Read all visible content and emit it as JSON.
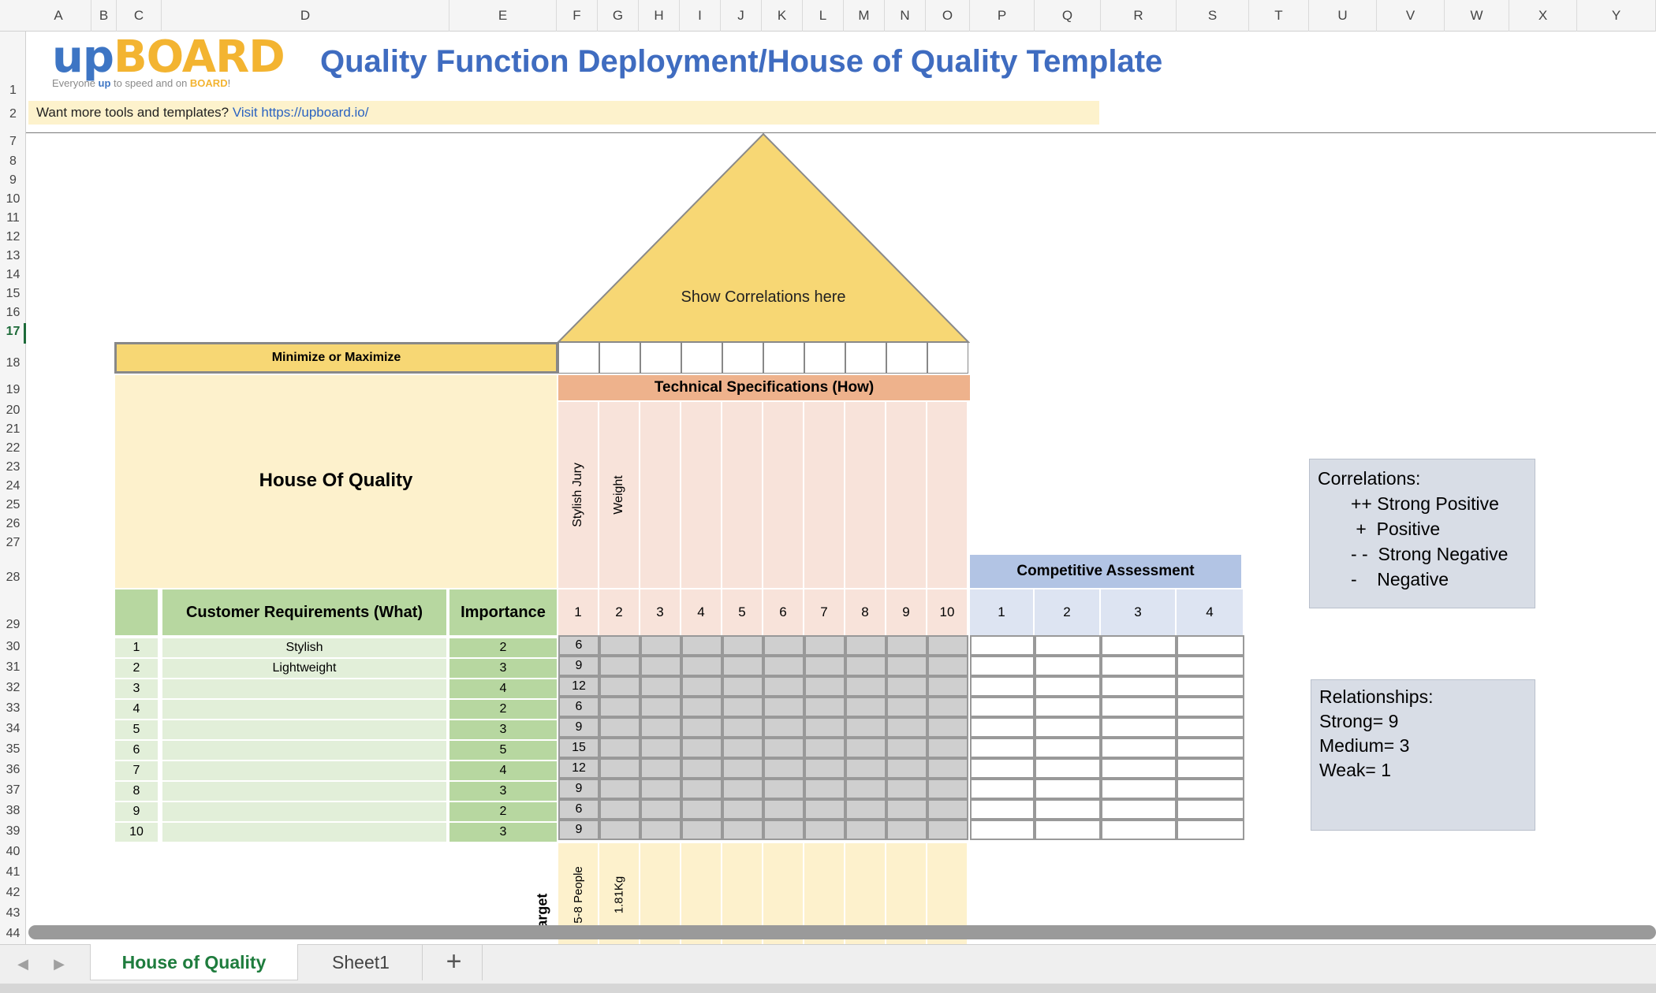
{
  "columns": [
    "A",
    "B",
    "C",
    "D",
    "E",
    "F",
    "G",
    "H",
    "I",
    "J",
    "K",
    "L",
    "M",
    "N",
    "O",
    "P",
    "Q",
    "R",
    "S",
    "T",
    "U",
    "V",
    "W",
    "X",
    "Y"
  ],
  "rows": [
    "1",
    "2",
    "7",
    "8",
    "9",
    "10",
    "11",
    "12",
    "13",
    "14",
    "15",
    "16",
    "17",
    "18",
    "19",
    "20",
    "21",
    "22",
    "23",
    "24",
    "25",
    "26",
    "27",
    "28",
    "29",
    "30",
    "31",
    "32",
    "33",
    "34",
    "35",
    "36",
    "37",
    "38",
    "39",
    "40",
    "41",
    "42",
    "43",
    "44"
  ],
  "logo": {
    "up": "up",
    "board": "BOARD",
    "tag_pre": "Everyone ",
    "tag_up": "up",
    "tag_mid": " to speed and on ",
    "tag_board": "BOARD",
    "tag_end": "!"
  },
  "page_title": "Quality Function Deployment/House of Quality Template",
  "promo": {
    "text": "Want more tools and templates? ",
    "link": "Visit https://upboard.io/"
  },
  "roof_label": "Show Correlations here",
  "minmax_label": "Minimize or Maximize",
  "tech_spec_header": "Technical Specifications (How)",
  "hoq_title": "House Of Quality",
  "spec_names": [
    "Stylish Jury",
    "Weight",
    "",
    "",
    "",
    "",
    "",
    "",
    "",
    ""
  ],
  "spec_numbers": [
    "1",
    "2",
    "3",
    "4",
    "5",
    "6",
    "7",
    "8",
    "9",
    "10"
  ],
  "comp_header": "Competitive Assessment",
  "comp_numbers": [
    "1",
    "2",
    "3",
    "4"
  ],
  "req_header": "Customer Requirements (What)",
  "importance_header": "Importance",
  "requirements": [
    {
      "idx": "1",
      "name": "Stylish",
      "importance": "2",
      "score": "6"
    },
    {
      "idx": "2",
      "name": "Lightweight",
      "importance": "3",
      "score": "9"
    },
    {
      "idx": "3",
      "name": "",
      "importance": "4",
      "score": "12"
    },
    {
      "idx": "4",
      "name": "",
      "importance": "2",
      "score": "6"
    },
    {
      "idx": "5",
      "name": "",
      "importance": "3",
      "score": "9"
    },
    {
      "idx": "6",
      "name": "",
      "importance": "5",
      "score": "15"
    },
    {
      "idx": "7",
      "name": "",
      "importance": "4",
      "score": "12"
    },
    {
      "idx": "8",
      "name": "",
      "importance": "3",
      "score": "9"
    },
    {
      "idx": "9",
      "name": "",
      "importance": "2",
      "score": "6"
    },
    {
      "idx": "10",
      "name": "",
      "importance": "3",
      "score": "9"
    }
  ],
  "target_label": "Target",
  "target_values": [
    "5-8 People",
    "1.81Kg",
    "",
    "",
    "",
    "",
    "",
    "",
    "",
    ""
  ],
  "correlations": {
    "title": "Correlations:",
    "items": [
      "++ Strong Positive",
      " +  Positive",
      "- -  Strong Negative",
      "-    Negative"
    ]
  },
  "relationships": {
    "title": "Relationships:",
    "items": [
      "Strong= 9",
      "Medium= 3",
      "Weak= 1"
    ]
  },
  "sheet_tabs": {
    "active": "House of Quality",
    "other": "Sheet1",
    "add": "+"
  },
  "nav": {
    "prev": "◀",
    "next": "▶"
  },
  "colors": {
    "title_blue": "#3f6cc0",
    "logo_orange": "#f3b431",
    "roof_yellow": "#f7d774",
    "spec_peach": "#eeb28c",
    "req_green": "#b7d7a0",
    "matrix_gray": "#cfcfcf",
    "comp_blue": "#b2c4e4",
    "tab_green": "#1e7c3d"
  }
}
